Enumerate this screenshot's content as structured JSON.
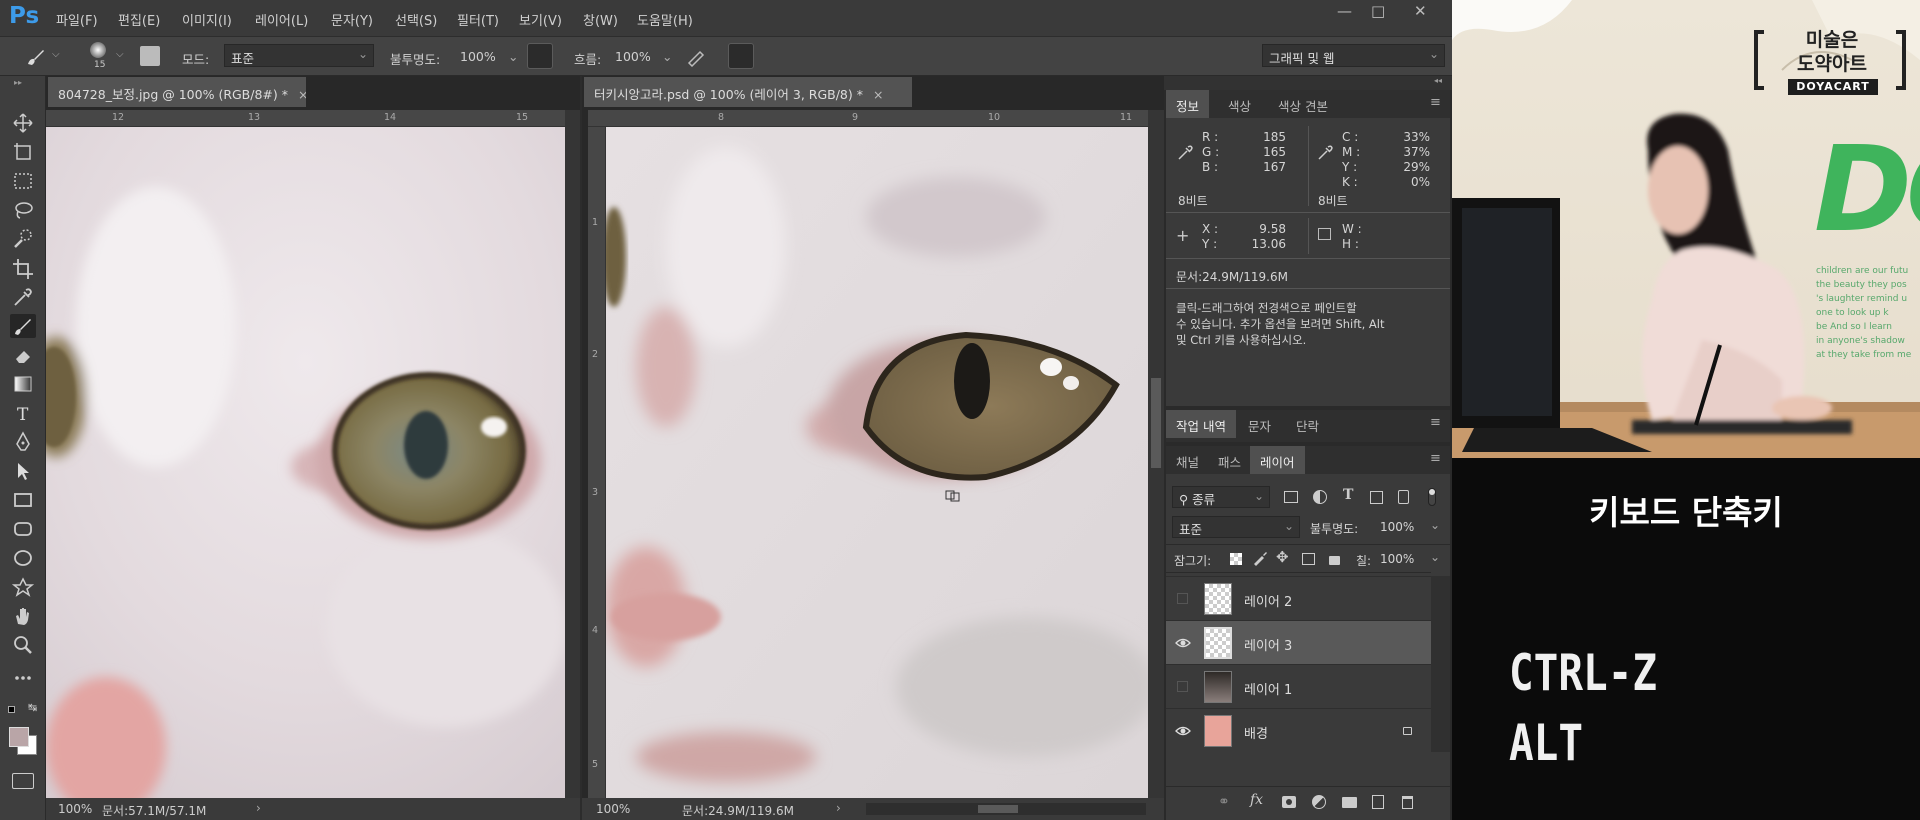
{
  "app": {
    "logo": "Ps",
    "menu": [
      "파일(F)",
      "편집(E)",
      "이미지(I)",
      "레이어(L)",
      "문자(Y)",
      "선택(S)",
      "필터(T)",
      "보기(V)",
      "창(W)",
      "도움말(H)"
    ]
  },
  "options": {
    "brush_size": "15",
    "mode_label": "모드:",
    "mode_value": "표준",
    "opacity_label": "불투명도:",
    "opacity_value": "100%",
    "flow_label": "흐름:",
    "flow_value": "100%",
    "workspace": "그래픽 및 웹"
  },
  "documents": [
    {
      "tab": "804728_보정.jpg @ 100% (RGB/8#) *",
      "close": "×",
      "zoom": "100%",
      "doc_info": "문서:57.1M/57.1M",
      "ruler_h": [
        "12",
        "13",
        "14",
        "15"
      ]
    },
    {
      "tab": "터키시앙고라.psd @ 100% (레이어 3, RGB/8) *",
      "close": "×",
      "zoom": "100%",
      "doc_info": "문서:24.9M/119.6M",
      "ruler_h": [
        "8",
        "9",
        "10",
        "11"
      ],
      "ruler_v": [
        "1",
        "2",
        "3",
        "4",
        "5"
      ]
    }
  ],
  "info_panel": {
    "tabs": [
      "정보",
      "색상",
      "색상 견본"
    ],
    "R": "185",
    "G": "165",
    "B": "167",
    "C": "33%",
    "M": "37%",
    "Y": "29%",
    "K": "0%",
    "bit_left": "8비트",
    "bit_right": "8비트",
    "X": "9.58",
    "Y_pos": "13.06",
    "W": "",
    "H": "",
    "doc": "문서:24.9M/119.6M",
    "hint": [
      "클릭-드래그하여 전경색으로 페인트할",
      "수 있습니다. 추가 옵션을 보려면 Shift, Alt",
      "및 Ctrl 키를 사용하십시오."
    ]
  },
  "history_panel": {
    "tabs": [
      "작업 내역",
      "문자",
      "단락"
    ]
  },
  "layers_panel": {
    "tabs": [
      "채널",
      "패스",
      "레이어"
    ],
    "filter": "종류",
    "blend": "표준",
    "opacity_label": "불투명도:",
    "opacity": "100%",
    "lock_label": "잠그기:",
    "fill_label": "칠:",
    "fill": "100%",
    "layers": [
      {
        "name": "레이어 2",
        "visible": false,
        "selected": false
      },
      {
        "name": "레이어 3",
        "visible": true,
        "selected": true
      },
      {
        "name": "레이어 1",
        "visible": false,
        "selected": false
      },
      {
        "name": "배경",
        "visible": true,
        "selected": false,
        "color": "#e8a49a"
      }
    ]
  },
  "video": {
    "logo_line1": "미술은",
    "logo_line2": "도약아트",
    "logo_sub": "DOYACART",
    "title": "키보드 단축키",
    "shortcut_1": "CTRL-Z",
    "shortcut_2": "ALT",
    "wall_text": "DO",
    "wall_lines": [
      "children are our futu",
      "the beauty they pos",
      "'s laughter remind u",
      "one to look up k",
      "be And so I learn",
      "in anyone's shadow",
      "at they take from me"
    ]
  },
  "colors": {
    "accent": "#3d9be9",
    "brand_green": "#2fb55a"
  }
}
